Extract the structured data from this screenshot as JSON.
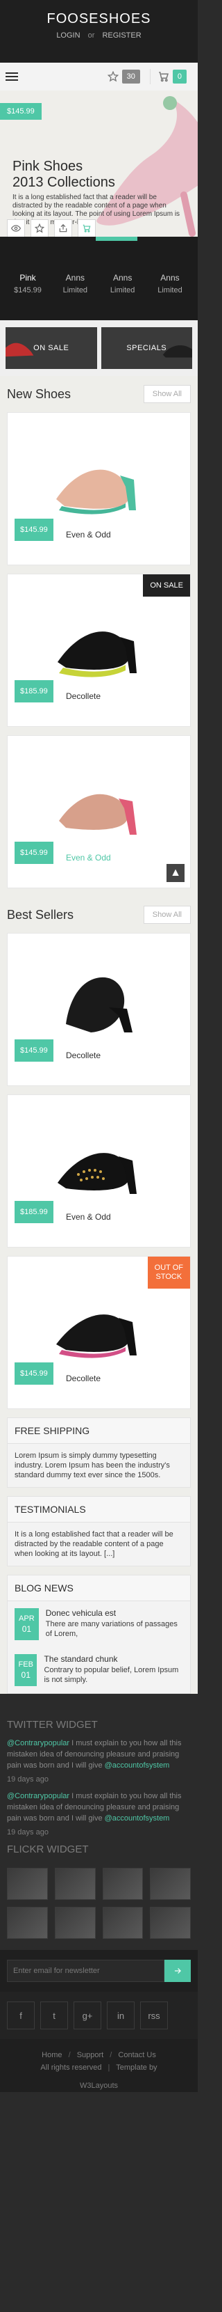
{
  "header": {
    "brand": "FOOSESHOES",
    "login": "LOGIN",
    "or": "or",
    "register": "REGISTER"
  },
  "toolbar": {
    "wishlist_count": "30",
    "cart_count": "0"
  },
  "hero": {
    "price": "$145.99",
    "title_line1": "Pink Shoes",
    "title_line2": "2013 Collections",
    "text": "It is a long established fact that a reader will be distracted by the readable content of a page when looking at its layout. The point of using Lorem Ipsum is that it has a more-or-less"
  },
  "thumbs": [
    {
      "name": "Pink",
      "price": "$145.99"
    },
    {
      "name": "Anns",
      "price": "Limited"
    },
    {
      "name": "Anns",
      "price": "Limited"
    },
    {
      "name": "Anns",
      "price": "Limited"
    }
  ],
  "banners": {
    "left": "ON SALE",
    "right": "SPECIALS"
  },
  "new_shoes": {
    "title": "New Shoes",
    "show_all": "Show All",
    "items": [
      {
        "price": "$145.99",
        "name": "Even & Odd",
        "badge": ""
      },
      {
        "price": "$185.99",
        "name": "Decollete",
        "badge": "ON SALE"
      },
      {
        "price": "$145.99",
        "name": "Even & Odd",
        "badge": ""
      }
    ]
  },
  "best_sellers": {
    "title": "Best Sellers",
    "show_all": "Show All",
    "items": [
      {
        "price": "$145.99",
        "name": "Decollete",
        "badge": ""
      },
      {
        "price": "$185.99",
        "name": "Even & Odd",
        "badge": ""
      },
      {
        "price": "$145.99",
        "name": "Decollete",
        "badge_line1": "OUT OF",
        "badge_line2": "STOCK"
      }
    ]
  },
  "free_shipping": {
    "title": "FREE SHIPPING",
    "text": "Lorem Ipsum is simply dummy typesetting industry. Lorem Ipsum has been the industry's standard dummy text ever since the 1500s."
  },
  "testimonials": {
    "title": "TESTIMONIALS",
    "text": "It is a long established fact that a reader will be distracted by the readable content of a page when looking at its layout. [...]"
  },
  "blog": {
    "title": "BLOG NEWS",
    "items": [
      {
        "month": "APR",
        "day": "01",
        "title": "Donec vehicula est",
        "text": "There are many variations of passages of Lorem,"
      },
      {
        "month": "FEB",
        "day": "01",
        "title": "The standard chunk",
        "text": "Contrary to popular belief, Lorem Ipsum is not simply."
      }
    ]
  },
  "twitter": {
    "title": "TWITTER WIDGET",
    "tweets": [
      {
        "handle": "@Contrarypopular",
        "text": " I must explain to you how all this mistaken idea of denouncing pleasure and praising pain was born and I will give ",
        "mention": "@accountofsystem",
        "ago": "19 days ago"
      },
      {
        "handle": "@Contrarypopular",
        "text": " I must explain to you how all this mistaken idea of denouncing pleasure and praising pain was born and I will give ",
        "mention": "@accountofsystem",
        "ago": "19 days ago"
      }
    ]
  },
  "flickr": {
    "title": "FLICKR WIDGET"
  },
  "newsletter": {
    "placeholder": "Enter email for newsletter"
  },
  "social": [
    "f",
    "t",
    "g+",
    "in",
    "rss"
  ],
  "footer": {
    "home": "Home",
    "support": "Support",
    "contact": "Contact Us",
    "rights": "All rights reserved",
    "template": "Template by",
    "brand": "W3Layouts"
  },
  "colors": {
    "accent": "#4fc7a6",
    "dark": "#2b2b2b",
    "sale_badge": "#222222",
    "out_of_stock": "#f36f3a"
  }
}
